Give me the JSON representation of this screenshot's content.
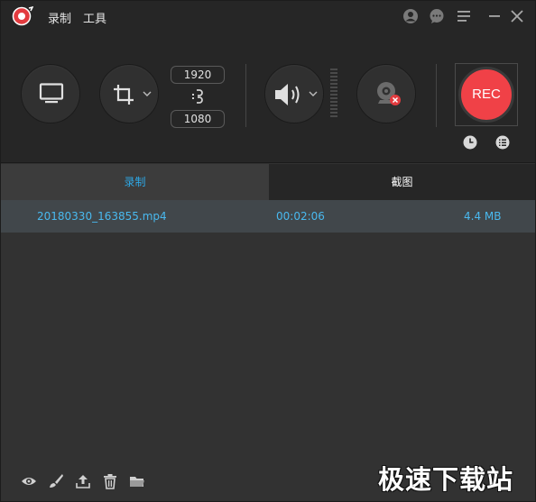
{
  "titlebar": {
    "menu": [
      {
        "label": "录制"
      },
      {
        "label": "工具"
      }
    ],
    "icons": [
      "user-icon",
      "chat-icon",
      "menu-icon",
      "minimize-icon",
      "close-icon"
    ]
  },
  "controls": {
    "width_value": "1920",
    "height_value": "1080",
    "record_label": "REC"
  },
  "tabs": [
    {
      "label": "录制",
      "active": true
    },
    {
      "label": "截图",
      "active": false
    }
  ],
  "files": [
    {
      "name": "20180330_163855.mp4",
      "duration": "00:02:06",
      "size": "4.4 MB"
    }
  ],
  "bottom_icons": [
    "eye-icon",
    "brush-icon",
    "upload-icon",
    "trash-icon",
    "folder-icon"
  ],
  "watermark": "极速下载站",
  "colors": {
    "accent": "#2ea8e6",
    "record": "#f04147",
    "file_text": "#49b9ef",
    "background": "#323232"
  }
}
